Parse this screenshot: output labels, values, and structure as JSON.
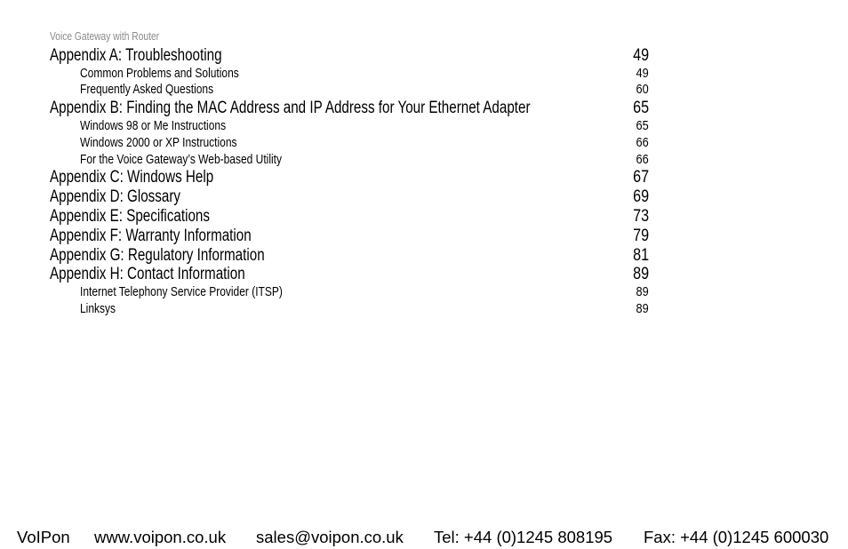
{
  "header": {
    "running_title": "Voice Gateway with Router"
  },
  "toc": {
    "entries": [
      {
        "level": 1,
        "title": "Appendix A: Troubleshooting",
        "page": "49"
      },
      {
        "level": 2,
        "title": "Common Problems and Solutions",
        "page": "49"
      },
      {
        "level": 2,
        "title": "Frequently Asked Questions",
        "page": "60"
      },
      {
        "level": 1,
        "title": "Appendix B: Finding the MAC Address and IP Address for Your Ethernet Adapter",
        "page": "65"
      },
      {
        "level": 2,
        "title": "Windows 98 or Me Instructions",
        "page": "65"
      },
      {
        "level": 2,
        "title": "Windows 2000 or XP Instructions",
        "page": "66"
      },
      {
        "level": 2,
        "title": "For the Voice Gateway’s Web-based Utility",
        "page": "66"
      },
      {
        "level": 1,
        "title": "Appendix C: Windows Help",
        "page": "67"
      },
      {
        "level": 1,
        "title": "Appendix D: Glossary",
        "page": "69"
      },
      {
        "level": 1,
        "title": "Appendix E: Specifications",
        "page": "73"
      },
      {
        "level": 1,
        "title": "Appendix F: Warranty Information",
        "page": "79"
      },
      {
        "level": 1,
        "title": "Appendix G: Regulatory Information",
        "page": "81"
      },
      {
        "level": 1,
        "title": "Appendix H: Contact Information",
        "page": "89"
      },
      {
        "level": 2,
        "title": "Internet Telephony Service Provider (ITSP)",
        "page": "89"
      },
      {
        "level": 2,
        "title": "Linksys",
        "page": "89"
      }
    ]
  },
  "footer": {
    "company": "VoIPon",
    "website": "www.voipon.co.uk",
    "email": "sales@voipon.co.uk",
    "tel": "Tel: +44 (0)1245 808195",
    "fax": "Fax: +44 (0)1245 600030"
  }
}
